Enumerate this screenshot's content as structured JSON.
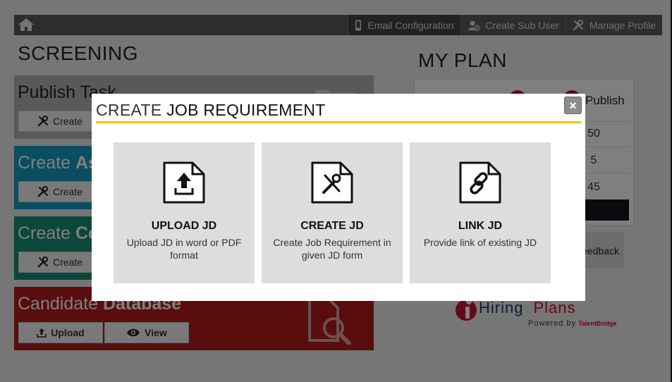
{
  "nav": {
    "items": [
      {
        "label": "Email Configuration",
        "icon": "phone-icon"
      },
      {
        "label": "Create Sub User",
        "icon": "add-user-icon"
      },
      {
        "label": "Manage Profile",
        "icon": "tools-icon"
      }
    ]
  },
  "screening": {
    "title": "SCREENING",
    "panels": [
      {
        "title_a": "Publish ",
        "title_b": "Task",
        "button": "Create",
        "color": "#b3b3b3"
      },
      {
        "title_a": "Create ",
        "title_b": "As",
        "button": "Create",
        "color": "#149cc0"
      },
      {
        "title_a": "Create ",
        "title_b": "Co",
        "button": "Create",
        "color": "#178e74"
      },
      {
        "title_a": "Candidate ",
        "title_b": "Database",
        "upload": "Upload",
        "view": "View",
        "color": "#b31b1b"
      }
    ]
  },
  "plan": {
    "title": "MY PLAN",
    "column_header": "Publish",
    "rows": [
      "50",
      "5",
      "45"
    ],
    "feedback": "eedback"
  },
  "brand": {
    "name_a": "Hiring",
    "name_b": "Plans",
    "powered": "Powered by",
    "partner": "TalentBridge"
  },
  "modal": {
    "title_light": "CREATE ",
    "title_bold": "JOB REQUIREMENT",
    "close_label": "×",
    "accent": "#f2c418",
    "options": [
      {
        "title": "UPLOAD JD",
        "desc": "Upload JD in word or PDF format",
        "icon": "upload-file-icon"
      },
      {
        "title": "CREATE JD",
        "desc": "Create Job Requirement in given JD form",
        "icon": "tools-file-icon"
      },
      {
        "title": "LINK JD",
        "desc": "Provide link of existing JD",
        "icon": "link-file-icon"
      }
    ]
  }
}
